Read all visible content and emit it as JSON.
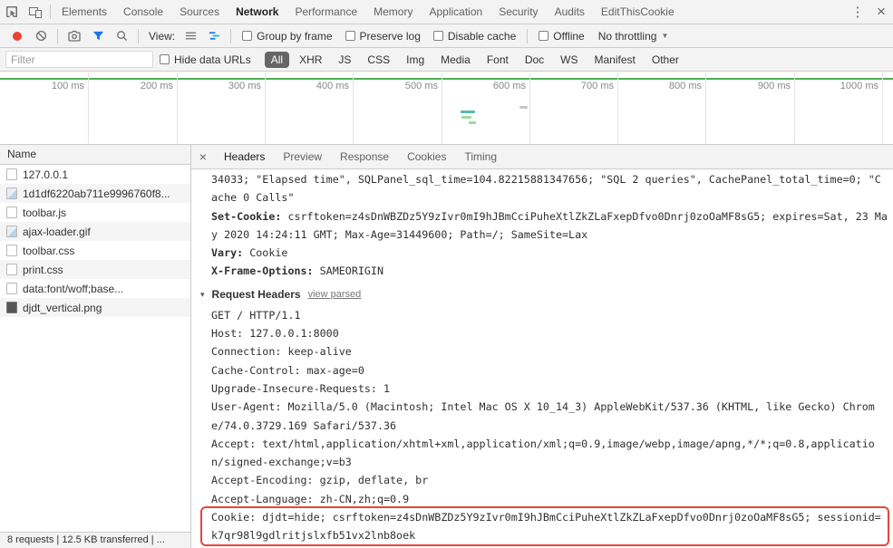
{
  "colors": {
    "accent": "#1a73e8",
    "record-red": "#ea4235",
    "highlight-red": "#e8453c",
    "timeline-green": "#4cae50",
    "waterfall-teal": "#58b9a8",
    "waterfall-green": "#9fd89f",
    "pill-selected-bg": "#666666"
  },
  "devtools": {
    "tabs": [
      "Elements",
      "Console",
      "Sources",
      "Network",
      "Performance",
      "Memory",
      "Application",
      "Security",
      "Audits",
      "EditThisCookie"
    ],
    "selected_tab": "Network",
    "kebab": "⋮",
    "close": "×"
  },
  "toolbar": {
    "view_label": "View:",
    "checkboxes": [
      "Group by frame",
      "Preserve log",
      "Disable cache"
    ],
    "offline_label": "Offline",
    "throttling_value": "No throttling",
    "caret": "▼"
  },
  "filter_bar": {
    "placeholder": "Filter",
    "hide_data_urls_label": "Hide data URLs",
    "types": [
      "All",
      "XHR",
      "JS",
      "CSS",
      "Img",
      "Media",
      "Font",
      "Doc",
      "WS",
      "Manifest",
      "Other"
    ],
    "selected_type": "All"
  },
  "timeline": {
    "labels": [
      "100 ms",
      "200 ms",
      "300 ms",
      "400 ms",
      "500 ms",
      "600 ms",
      "700 ms",
      "800 ms",
      "900 ms",
      "1000 ms"
    ]
  },
  "requests": {
    "column_header": "Name",
    "rows": [
      {
        "name": "127.0.0.1",
        "icon": "document"
      },
      {
        "name": "1d1df6220ab711e9996760f8...",
        "icon": "image"
      },
      {
        "name": "toolbar.js",
        "icon": "document"
      },
      {
        "name": "ajax-loader.gif",
        "icon": "image"
      },
      {
        "name": "toolbar.css",
        "icon": "document"
      },
      {
        "name": "print.css",
        "icon": "document"
      },
      {
        "name": "data:font/woff;base...",
        "icon": "document"
      },
      {
        "name": "djdt_vertical.png",
        "icon": "image-dark"
      }
    ]
  },
  "details": {
    "close": "×",
    "tabs": [
      "Headers",
      "Preview",
      "Response",
      "Cookies",
      "Timing"
    ],
    "selected_tab": "Headers",
    "response_lines": [
      {
        "text": "34033; \"Elapsed time\", SQLPanel_sql_time=104.82215881347656; \"SQL 2 queries\", CachePanel_total_time=0; \"C"
      },
      {
        "text": "ache 0 Calls\""
      },
      {
        "label": "Set-Cookie:",
        "text": " csrftoken=z4sDnWBZDz5Y9zIvr0mI9hJBmCciPuheXtlZkZLaFxepDfvo0Dnrj0zoOaMF8sG5; expires=Sat, 23 Ma"
      },
      {
        "text": "y 2020 14:24:11 GMT; Max-Age=31449600; Path=/; SameSite=Lax"
      },
      {
        "label": "Vary:",
        "text": " Cookie"
      },
      {
        "label": "X-Frame-Options:",
        "text": " SAMEORIGIN"
      }
    ],
    "request_section": {
      "disclosure": "▾",
      "title": "Request Headers",
      "link": "view parsed"
    },
    "request_lines": [
      "GET / HTTP/1.1",
      "Host: 127.0.0.1:8000",
      "Connection: keep-alive",
      "Cache-Control: max-age=0",
      "Upgrade-Insecure-Requests: 1",
      "User-Agent: Mozilla/5.0 (Macintosh; Intel Mac OS X 10_14_3) AppleWebKit/537.36 (KHTML, like Gecko) Chrom",
      "e/74.0.3729.169 Safari/537.36",
      "Accept: text/html,application/xhtml+xml,application/xml;q=0.9,image/webp,image/apng,*/*;q=0.8,applicatio",
      "n/signed-exchange;v=b3",
      "Accept-Encoding: gzip, deflate, br",
      "Accept-Language: zh-CN,zh;q=0.9"
    ],
    "cookie_lines": [
      "Cookie: djdt=hide; csrftoken=z4sDnWBZDz5Y9zIvr0mI9hJBmCciPuheXtlZkZLaFxepDfvo0Dnrj0zoOaMF8sG5; sessionid=",
      "k7qr98l9gdlritjslxfb51vx2lnb8oek"
    ]
  },
  "status_bar": {
    "text": "8 requests | 12.5 KB transferred | ..."
  }
}
